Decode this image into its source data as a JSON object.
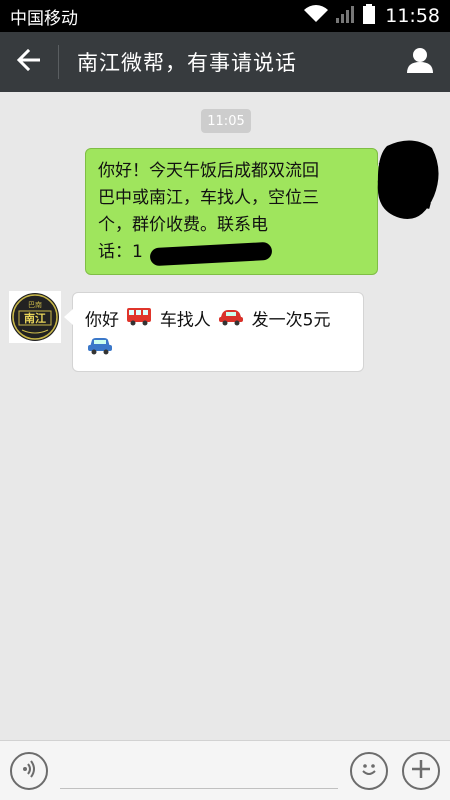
{
  "status_bar": {
    "carrier": "中国移动",
    "time": "11:58"
  },
  "header": {
    "title": "南江微帮，有事请说话"
  },
  "chat": {
    "timestamp": "11:05",
    "messages": [
      {
        "sender": "self",
        "lines": [
          "你好！今天午饭后成都双流回",
          "巴中或南江，车找人，空位三",
          "个，群价收费。联系电",
          "话：1"
        ]
      },
      {
        "sender": "other",
        "parts": [
          "你好",
          "车找人",
          "发一次5元"
        ],
        "avatar_text": [
          "巴南",
          "南江"
        ]
      }
    ]
  },
  "input": {
    "value": "",
    "placeholder": ""
  },
  "colors": {
    "header_bg": "#373b3e",
    "outgoing_bubble": "#9fe55d",
    "incoming_bubble": "#ffffff",
    "chat_bg": "#e8e8e8"
  },
  "icons": {
    "back": "arrow-left-icon",
    "profile": "person-icon",
    "voice": "voice-icon",
    "emoji": "emoji-icon",
    "add": "plus-icon",
    "wifi": "wifi-icon",
    "signal": "signal-icon",
    "battery": "battery-icon"
  }
}
